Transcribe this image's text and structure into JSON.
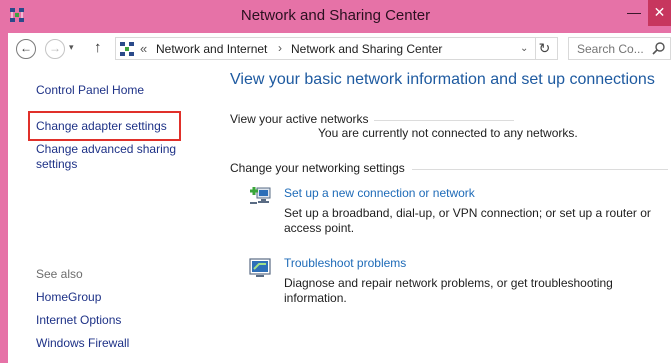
{
  "window": {
    "title": "Network and Sharing Center",
    "minimize": "—",
    "close": "✕",
    "accent": "#e672a7"
  },
  "addressbar": {
    "back": "←",
    "forward": "→",
    "recent": "▾",
    "up": "↑",
    "chevron": "«",
    "crumbs": [
      "Network and Internet",
      "Network and Sharing Center"
    ],
    "separator": "›",
    "dropdown": "⌄",
    "refresh": "↻",
    "search_placeholder": "Search Co..."
  },
  "sidebar": {
    "home": "Control Panel Home",
    "change_adapter": "Change adapter settings",
    "change_advanced": "Change advanced sharing settings",
    "see_also_heading": "See also",
    "see_also": [
      "HomeGroup",
      "Internet Options",
      "Windows Firewall"
    ]
  },
  "main": {
    "title": "View your basic network information and set up connections",
    "active_heading": "View your active networks",
    "no_networks": "You are currently not connected to any networks.",
    "change_heading": "Change your networking settings",
    "tasks": [
      {
        "icon": "new-connection-icon",
        "link": "Set up a new connection or network",
        "desc": "Set up a broadband, dial-up, or VPN connection; or set up a router or access point."
      },
      {
        "icon": "troubleshoot-icon",
        "link": "Troubleshoot problems",
        "desc": "Diagnose and repair network problems, or get troubleshooting information."
      }
    ]
  }
}
